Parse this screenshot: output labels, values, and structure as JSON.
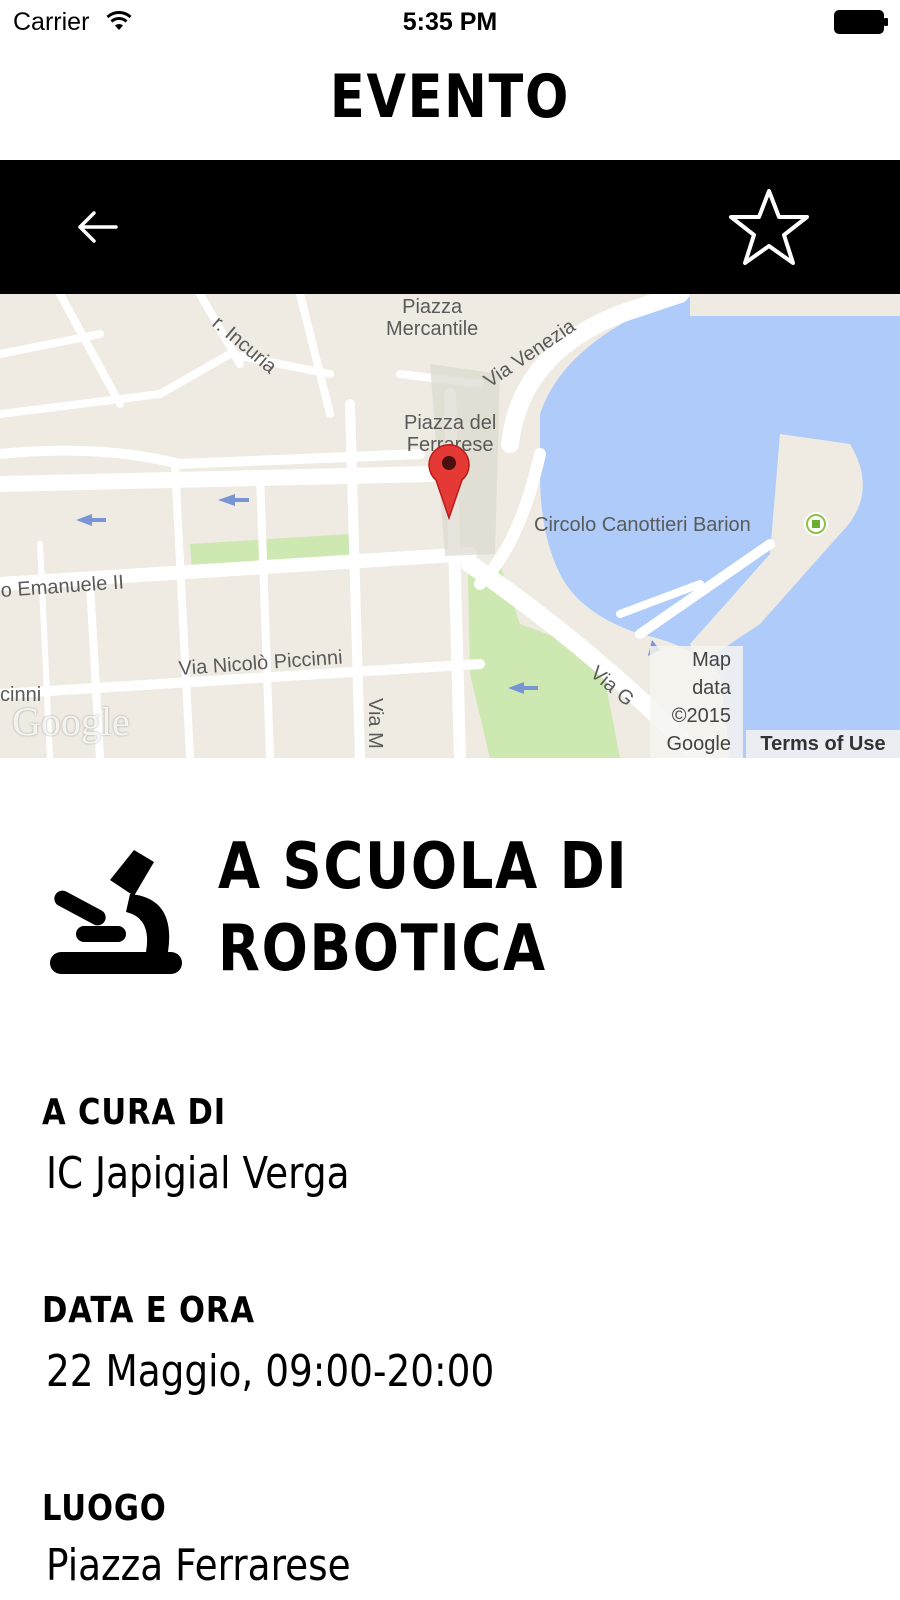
{
  "status_bar": {
    "carrier": "Carrier",
    "time": "5:35 PM"
  },
  "header": {
    "title": "EVENTO"
  },
  "toolbar": {
    "back_icon": "arrow-left-icon",
    "favorite_icon": "star-outline-icon"
  },
  "map": {
    "labels": {
      "piazza_mercantile": "Piazza\nMercantile",
      "incuria": "r. Incuria",
      "via_venezia": "Via Venezia",
      "piazza_ferrarese": "Piazza del\nFerrarese",
      "circolo": "Circolo Canottieri Barion",
      "emanuele": "o Emanuele II",
      "piccinni": "Via Nicolò Piccinni",
      "cinni": "cinni",
      "via_m": "Via M",
      "via_g": "Via G"
    },
    "logo": "Google",
    "attribution": "Map\ndata\n©2015\nGoogle",
    "terms": "Terms of Use",
    "colors": {
      "water": "#aecbfa",
      "land": "#efebe2",
      "road": "#ffffff",
      "park": "#cde8b0",
      "pin": "#e53935"
    }
  },
  "event": {
    "icon": "microscope-icon",
    "title": "A SCUOLA DI ROBOTICA"
  },
  "details": {
    "organizer_label": "A CURA DI",
    "organizer_value": "IC Japigial Verga",
    "datetime_label": "DATA E ORA",
    "datetime_value": "22 Maggio, 09:00-20:00",
    "place_label": "LUOGO",
    "place_value": "Piazza Ferrarese"
  }
}
